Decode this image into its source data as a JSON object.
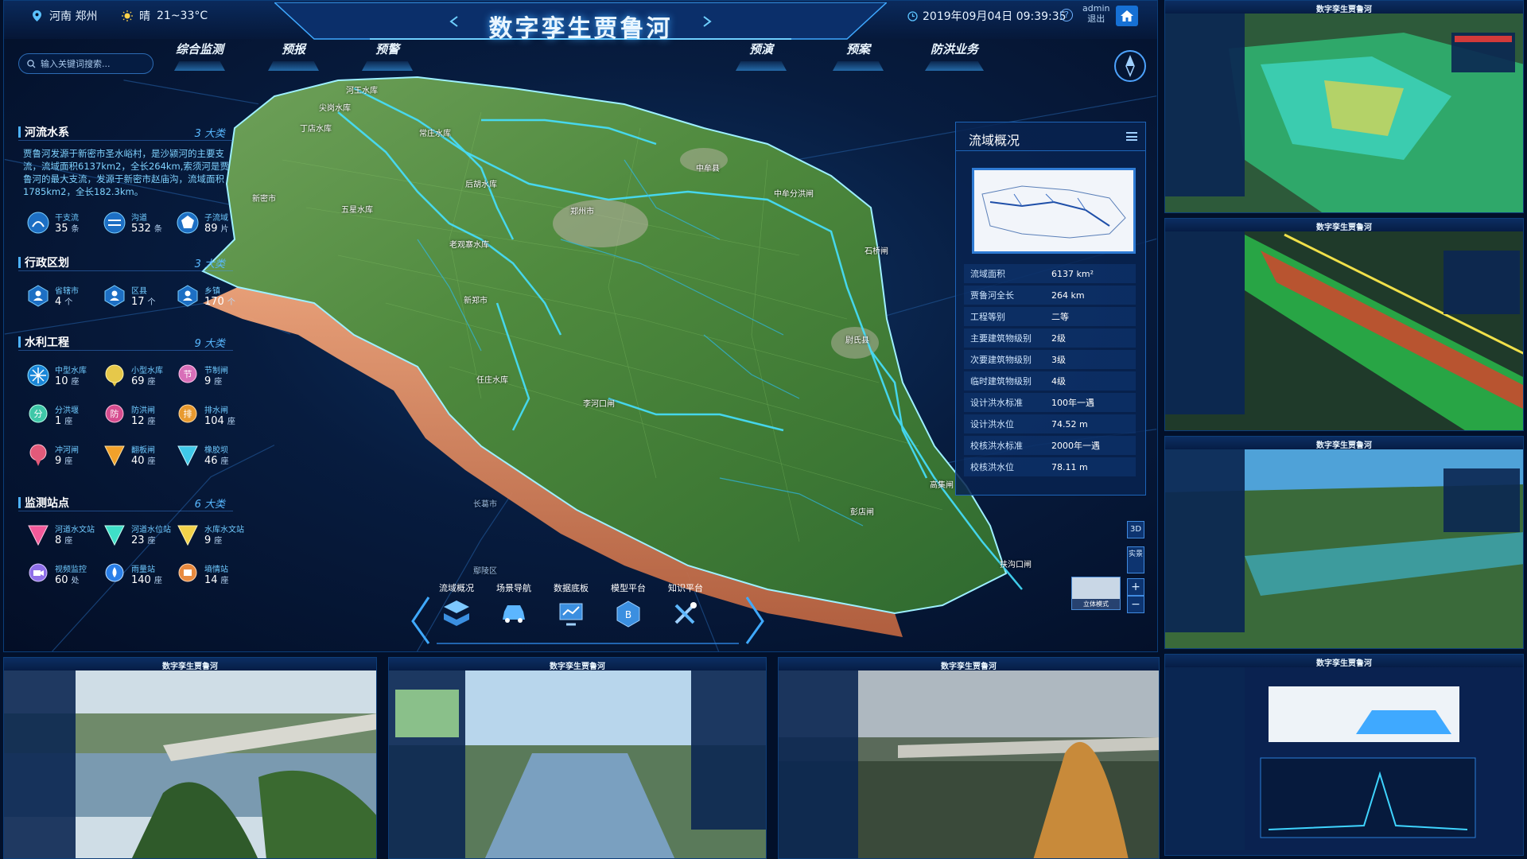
{
  "header": {
    "location": "河南 郑州",
    "weather": "晴",
    "temperature": "21~33°C",
    "title": "数字孪生贾鲁河",
    "datetime": "2019年09月04日 09:39:35",
    "user": "admin",
    "logout": "退出"
  },
  "nav": {
    "left_tabs": [
      "综合监测",
      "预报",
      "预警"
    ],
    "right_tabs": [
      "预演",
      "预案",
      "防洪业务"
    ]
  },
  "search": {
    "placeholder": "输入关键词搜索..."
  },
  "left_panel": {
    "rivers": {
      "title": "河流水系",
      "count": "3 大类",
      "description": "贾鲁河发源于新密市圣水峪村，是沙颍河的主要支流，流域面积6137km2，全长264km,索须河是贾鲁河的最大支流，发源于新密市赵庙沟，流域面积1785km2，全长182.3km。",
      "stats": [
        {
          "label": "干支流",
          "value": "35",
          "unit": "条"
        },
        {
          "label": "沟道",
          "value": "532",
          "unit": "条"
        },
        {
          "label": "子流域",
          "value": "89",
          "unit": "片"
        }
      ]
    },
    "admin": {
      "title": "行政区划",
      "count": "3 大类",
      "stats": [
        {
          "label": "省辖市",
          "value": "4",
          "unit": "个"
        },
        {
          "label": "区县",
          "value": "17",
          "unit": "个"
        },
        {
          "label": "乡镇",
          "value": "170",
          "unit": "个"
        }
      ]
    },
    "water": {
      "title": "水利工程",
      "count": "9 大类",
      "stats": [
        {
          "label": "中型水库",
          "value": "10",
          "unit": "座"
        },
        {
          "label": "小型水库",
          "value": "69",
          "unit": "座"
        },
        {
          "label": "节制闸",
          "value": "9",
          "unit": "座"
        },
        {
          "label": "分洪堰",
          "value": "1",
          "unit": "座"
        },
        {
          "label": "防洪闸",
          "value": "12",
          "unit": "座"
        },
        {
          "label": "排水闸",
          "value": "104",
          "unit": "座"
        },
        {
          "label": "冲河闸",
          "value": "9",
          "unit": "座"
        },
        {
          "label": "翻板闸",
          "value": "40",
          "unit": "座"
        },
        {
          "label": "橡胶坝",
          "value": "46",
          "unit": "座"
        }
      ]
    },
    "monitor": {
      "title": "监测站点",
      "count": "6 大类",
      "stats": [
        {
          "label": "河道水文站",
          "value": "8",
          "unit": "座"
        },
        {
          "label": "河道水位站",
          "value": "23",
          "unit": "座"
        },
        {
          "label": "水库水文站",
          "value": "9",
          "unit": "座"
        },
        {
          "label": "视频监控",
          "value": "60",
          "unit": "处"
        },
        {
          "label": "雨量站",
          "value": "140",
          "unit": "座"
        },
        {
          "label": "墒情站",
          "value": "14",
          "unit": "座"
        }
      ]
    }
  },
  "map_labels": [
    "河王水库",
    "常庄水库",
    "丁店水库",
    "新密市",
    "五星水库",
    "尖岗水库",
    "后胡水库",
    "老观寨水库",
    "新郑市",
    "中牟县",
    "郑州市",
    "中牟分洪闸",
    "石桥闸",
    "尉氏县",
    "李河口闸",
    "高集闸",
    "彭店闸",
    "任庄水库",
    "扶沟口闸",
    "长葛市",
    "鄢陵区"
  ],
  "basin": {
    "title": "流域概况",
    "rows": [
      {
        "k": "流域面积",
        "v": "6137 km²"
      },
      {
        "k": "贾鲁河全长",
        "v": "264 km"
      },
      {
        "k": "工程等别",
        "v": "二等"
      },
      {
        "k": "主要建筑物级别",
        "v": "2级"
      },
      {
        "k": "次要建筑物级别",
        "v": "3级"
      },
      {
        "k": "临时建筑物级别",
        "v": "4级"
      },
      {
        "k": "设计洪水标准",
        "v": "100年一遇"
      },
      {
        "k": "设计洪水位",
        "v": "74.52 m"
      },
      {
        "k": "校核洪水标准",
        "v": "2000年一遇"
      },
      {
        "k": "校核洪水位",
        "v": "78.11 m"
      }
    ]
  },
  "map_controls": {
    "btn_3d": "3D",
    "btn_real": "实景",
    "btn_zoom_in": "+",
    "btn_zoom_out": "−",
    "mode": "立体模式"
  },
  "toolbar": [
    {
      "label": "流域概况"
    },
    {
      "label": "场景导航"
    },
    {
      "label": "数据底板"
    },
    {
      "label": "模型平台"
    },
    {
      "label": "知识平台"
    }
  ],
  "thumbnails": {
    "title": "数字孪生贾鲁河"
  },
  "colors": {
    "accent": "#3fa9ff",
    "river": "#46e0ff",
    "bg": "#02102a"
  }
}
